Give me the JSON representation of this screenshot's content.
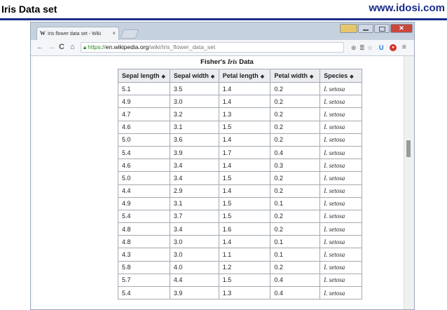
{
  "slide": {
    "title": "Iris Data set",
    "brand": "www.idosi.com"
  },
  "browser": {
    "tab_title": "Iris flower data set - Wiki",
    "tab_close": "×",
    "url": {
      "scheme": "https://",
      "host": "en.wikipedia.org",
      "path": "/wiki/Iris_flower_data_set"
    },
    "icons": {
      "back": "back-arrow-icon",
      "forward": "forward-arrow-icon",
      "reload": "reload-icon",
      "home": "home-icon",
      "lock": "lock-icon",
      "zoom": "zoom-icon",
      "reader": "reader-icon",
      "star": "bookmark-star-icon",
      "ext1": "extension-icon",
      "ext2": "extension-icon",
      "menu": "menu-icon"
    }
  },
  "table": {
    "caption_prefix": "Fisher's ",
    "caption_italic": "Iris",
    "caption_suffix": " Data",
    "headers": [
      "Sepal length",
      "Sepal width",
      "Petal length",
      "Petal width",
      "Species"
    ],
    "rows": [
      [
        "5.1",
        "3.5",
        "1.4",
        "0.2",
        "I. setosa"
      ],
      [
        "4.9",
        "3.0",
        "1.4",
        "0.2",
        "I. setosa"
      ],
      [
        "4.7",
        "3.2",
        "1.3",
        "0.2",
        "I. setosa"
      ],
      [
        "4.6",
        "3.1",
        "1.5",
        "0.2",
        "I. setosa"
      ],
      [
        "5.0",
        "3.6",
        "1.4",
        "0.2",
        "I. setosa"
      ],
      [
        "5.4",
        "3.9",
        "1.7",
        "0.4",
        "I. setosa"
      ],
      [
        "4.6",
        "3.4",
        "1.4",
        "0.3",
        "I. setosa"
      ],
      [
        "5.0",
        "3.4",
        "1.5",
        "0.2",
        "I. setosa"
      ],
      [
        "4.4",
        "2.9",
        "1.4",
        "0.2",
        "I. setosa"
      ],
      [
        "4.9",
        "3.1",
        "1.5",
        "0.1",
        "I. setosa"
      ],
      [
        "5.4",
        "3.7",
        "1.5",
        "0.2",
        "I. setosa"
      ],
      [
        "4.8",
        "3.4",
        "1.6",
        "0.2",
        "I. setosa"
      ],
      [
        "4.8",
        "3.0",
        "1.4",
        "0.1",
        "I. setosa"
      ],
      [
        "4.3",
        "3.0",
        "1.1",
        "0.1",
        "I. setosa"
      ],
      [
        "5.8",
        "4.0",
        "1.2",
        "0.2",
        "I. setosa"
      ],
      [
        "5.7",
        "4.4",
        "1.5",
        "0.4",
        "I. setosa"
      ],
      [
        "5.4",
        "3.9",
        "1.3",
        "0.4",
        "I. setosa"
      ]
    ]
  }
}
